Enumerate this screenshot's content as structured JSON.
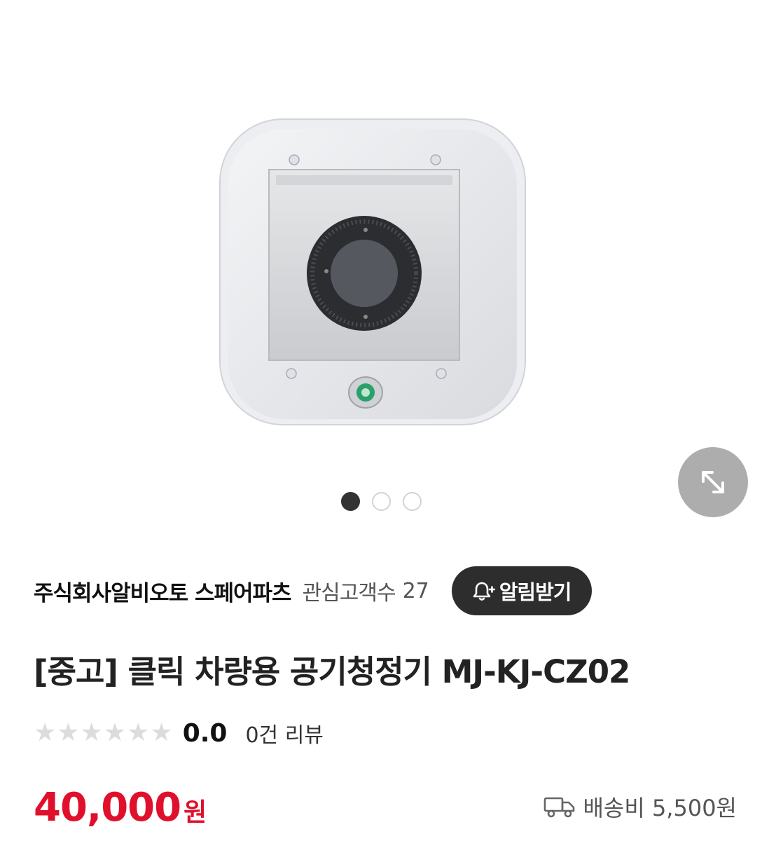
{
  "gallery": {
    "total_images": 3,
    "current_index": 1,
    "expand_icon": "expand-arrows-icon"
  },
  "seller": {
    "name": "주식회사알비오토 스페어파츠",
    "interest_label": "관심고객수",
    "interest_count": "27",
    "alert_button_label": "알림받기",
    "alert_icon": "bell-plus-icon"
  },
  "product": {
    "title": "[중고] 클릭 차량용 공기청정기 MJ-KJ-CZ02",
    "rating": {
      "stars_filled": 0,
      "stars_total": 6,
      "score": "0.0",
      "review_count_label": "0건 리뷰"
    },
    "price": {
      "amount": "40,000",
      "unit": "원"
    },
    "shipping": {
      "icon": "truck-icon",
      "label": "배송비 5,500원"
    }
  },
  "colors": {
    "price_red": "#e0102c",
    "alert_button_bg": "#2d2d2d",
    "star_empty": "#dcdcdc"
  }
}
